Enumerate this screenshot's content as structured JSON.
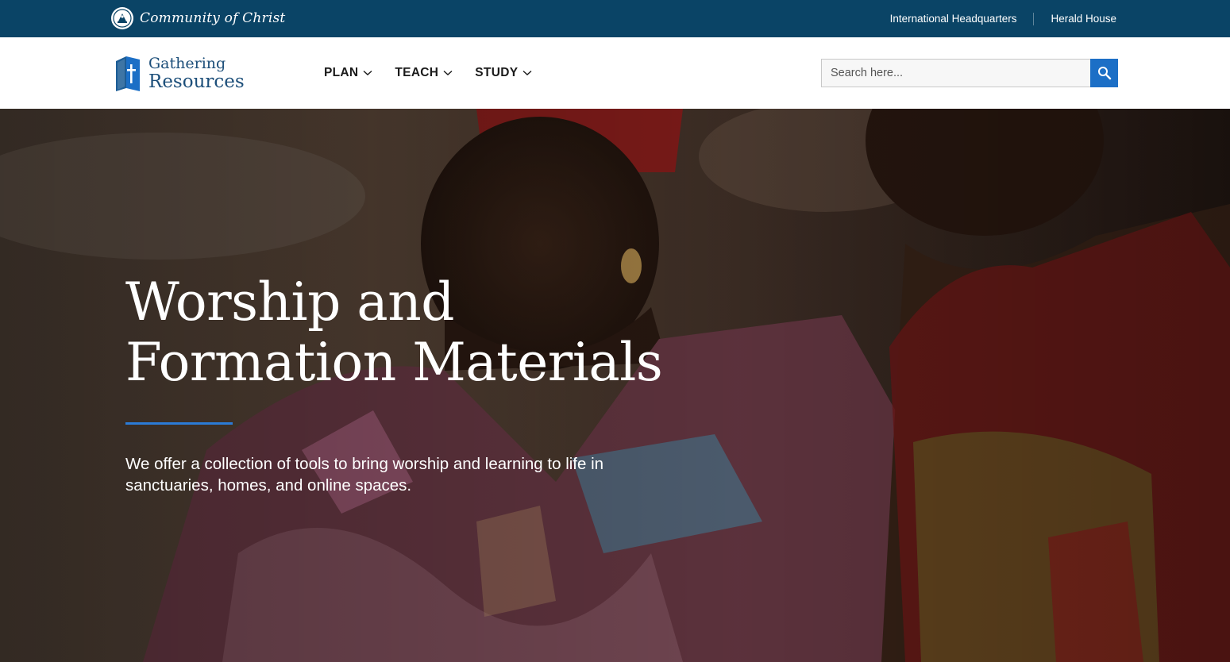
{
  "topbar": {
    "org_name": "Community of Christ",
    "links": [
      {
        "label": "International Headquarters"
      },
      {
        "label": "Herald House"
      }
    ],
    "background": "#0a4466"
  },
  "header": {
    "brand": {
      "line1": "Gathering",
      "line2": "Resources"
    },
    "nav": [
      {
        "label": "PLAN"
      },
      {
        "label": "TEACH"
      },
      {
        "label": "STUDY"
      }
    ],
    "search": {
      "placeholder": "Search here...",
      "button_icon": "search-icon"
    },
    "accent": "#1c6fc6"
  },
  "hero": {
    "title": "Worship and Formation Materials",
    "subtitle": "We offer a collection of tools to bring worship and learning to life in sanctuaries, homes, and online spaces.",
    "rule_color": "#2b7bd6"
  }
}
